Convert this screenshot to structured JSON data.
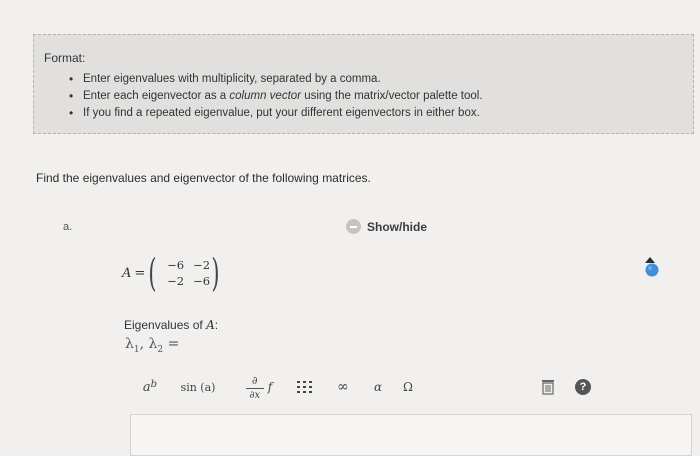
{
  "format": {
    "title": "Format:",
    "items": [
      {
        "text": "Enter eigenvalues with multiplicity, separated by a comma."
      },
      {
        "pre": "Enter each eigenvector as a ",
        "em": "column vector",
        "post": " using the matrix/vector palette tool."
      },
      {
        "text": "If you find a repeated eigenvalue, put your different eigenvectors in either box."
      }
    ]
  },
  "question": "Find the eigenvalues and eigenvector of the following matrices.",
  "part": {
    "label": "a.",
    "show_hide": "Show/hide",
    "matrix": {
      "var": "A",
      "eq": "=",
      "rows": [
        [
          "−6",
          "−2"
        ],
        [
          "−2",
          "−6"
        ]
      ]
    },
    "eigen_label_pre": "Eigenvalues of ",
    "eigen_label_var": "A",
    "eigen_label_post": ":",
    "lambda_prefix": "λ",
    "lambda1_sub": "1",
    "lambda_sep": ", λ",
    "lambda2_sub": "2",
    "lambda_eq": " ="
  },
  "toolbar": {
    "power_base": "a",
    "power_exp": "b",
    "sin": "sin (a)",
    "deriv_num": "∂",
    "deriv_den": "∂x",
    "deriv_f": "f",
    "infinity": "∞",
    "alpha": "α",
    "omega": "Ω",
    "help": "?"
  },
  "icons": {
    "show_hide": "minus-circle-icon",
    "matrix": "matrix-grid-icon",
    "trash": "trash-icon",
    "help": "question-circle-icon",
    "side": "blue-dot-arrow-icon"
  },
  "colors": {
    "format_bg": "#e1e0df",
    "page_bg": "#f1f0ef",
    "accent_blue": "#3f8fd8"
  }
}
